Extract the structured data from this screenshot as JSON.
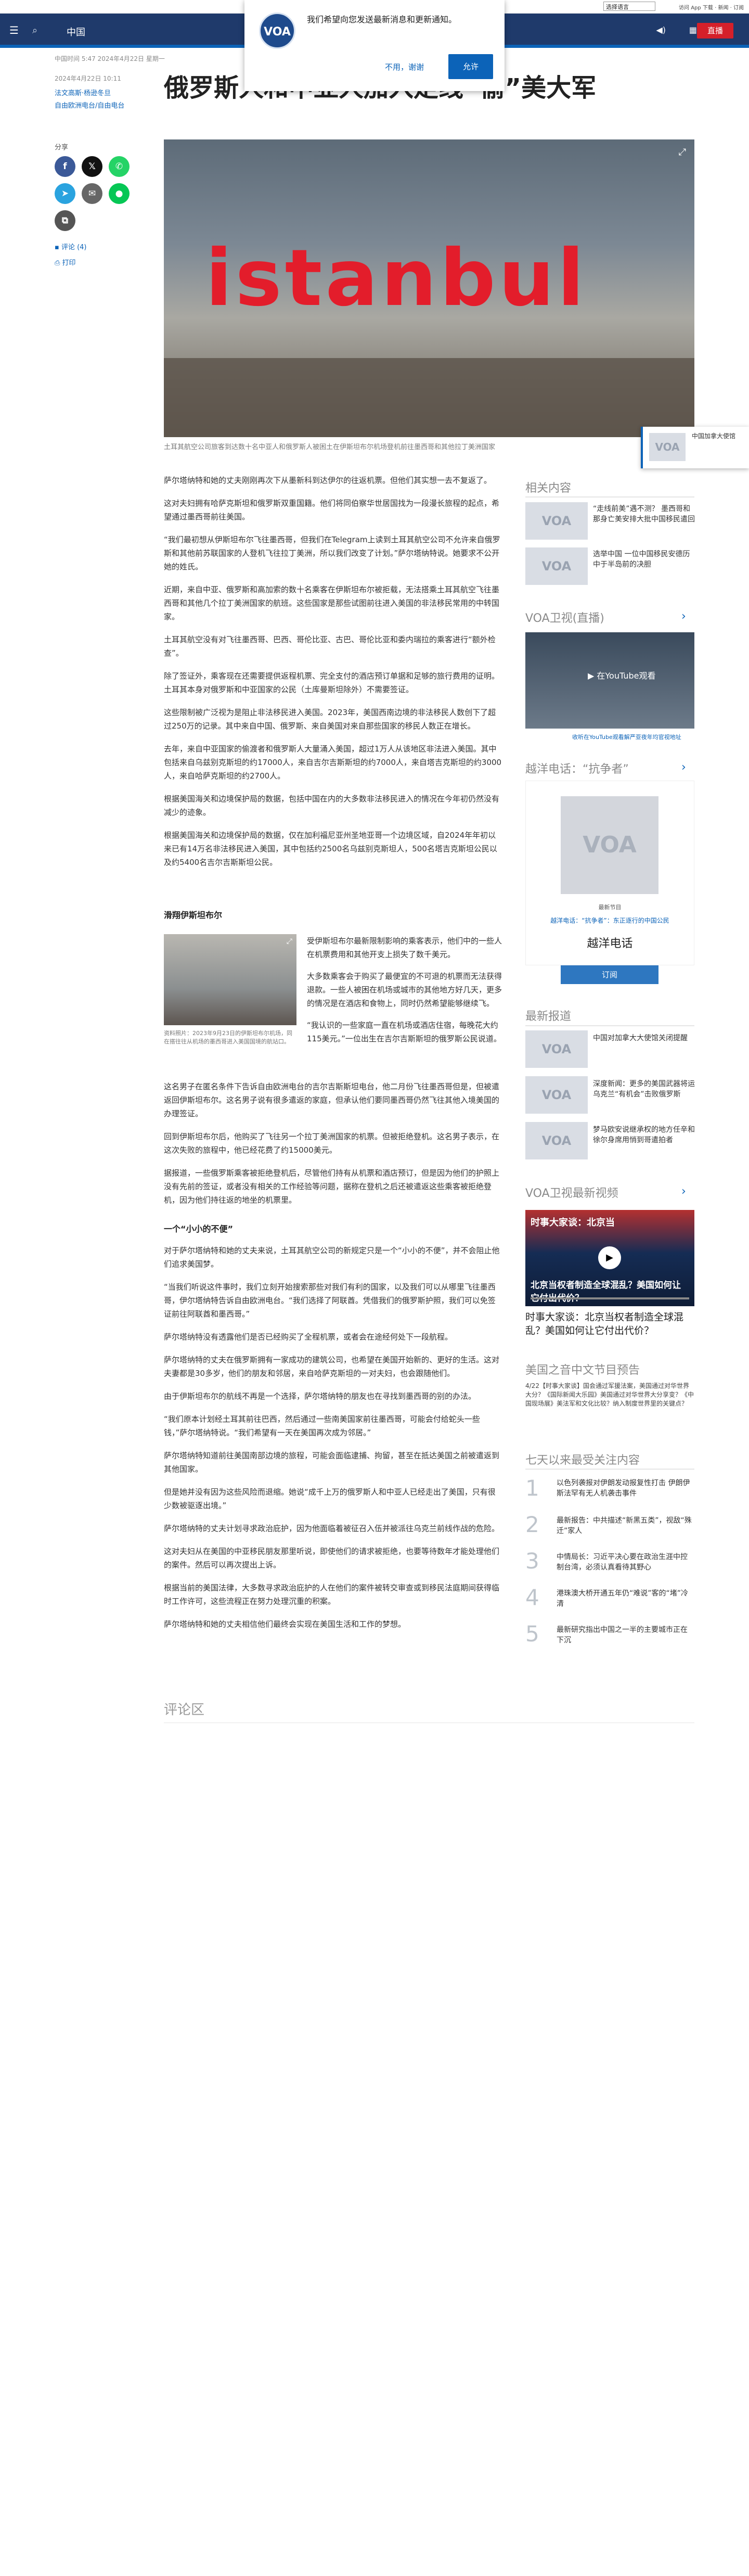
{
  "util": {
    "lang_selected": "选择语言",
    "links": "访问 App 下载 · 新闻 · 订阅"
  },
  "nav": {
    "menu_icon": "menu-icon",
    "search_icon": "search-icon",
    "section": "中国",
    "live_label": "直播"
  },
  "popup": {
    "logo": "VOA",
    "message": "我们希望向您发送最新消息和更新通知。",
    "decline": "不用，谢谢",
    "accept": "允许"
  },
  "meta": {
    "updated": "中国时间 5:47 2024年4月22日 星期一",
    "published": "2024年4月22日 10:11",
    "author_link": "法文高斯·杨逊冬旦",
    "outlet_link": "自由欧洲电台/自由电台"
  },
  "article": {
    "title": "俄罗斯人和中亚人加入走线“偷”美大军",
    "hero_sign": "istanbul",
    "hero_caption": "土耳其航空公司旅客到达数十名中亚人和俄罗斯人被困土在伊斯坦布尔机场登机前往墨西哥和其他拉丁美洲国家",
    "paragraphs_1": [
      "萨尔塔纳特和她的丈夫刚刚再次下从墨新科到达伊尔的往返机票。但他们其实想一去不复返了。",
      "这对夫妇拥有哈萨克斯坦和俄罗斯双重国籍。他们将同伯察华世居国找为一段漫长旅程的起点，希望通过墨西哥前往美国。",
      "“我们最初想从伊斯坦布尔飞往墨西哥，但我们在Telegram上读到土耳其航空公司不允许来自俄罗斯和其他前苏联国家的人登机飞往拉丁美洲，所以我们改变了计划。”萨尔塔纳特说。她要求不公开她的姓氏。",
      "近期，来自中亚、俄罗斯和高加索的数十名乘客在伊斯坦布尔被拒载，无法搭乘土耳其航空飞往墨西哥和其他几个拉丁美洲国家的航班。这些国家是那些试图前往进入美国的非法移民常用的中转国家。",
      "土耳其航空没有对飞往墨西哥、巴西、哥伦比亚、古巴、哥伦比亚和委内瑞拉的乘客进行“额外检查”。",
      "除了签证外，乘客现在还需要提供返程机票、完全支付的酒店预订单据和足够的旅行费用的证明。土耳其本身对俄罗斯和中亚国家的公民（土库曼斯坦除外）不需要签证。",
      "这些限制被广泛视为是阻止非法移民进入美国。2023年，美国西南边境的非法移民人数创下了超过250万的记录。其中来自中国、俄罗斯、来自美国对来自那些国家的移民人数正在增长。",
      "去年，来自中亚国家的偷渡者和俄罗斯人大量涌入美国，超过1万人从该地区非法进入美国。其中包括来自乌兹别克斯坦的约17000人，来自吉尔吉斯斯坦的约7000人，来自塔吉克斯坦的约3000人，来自哈萨克斯坦的约2700人。",
      "根据美国海关和边境保护局的数据，包括中国在内的大多数非法移民进入的情况在今年初仍然没有减少的迹象。",
      "根据美国海关和边境保护局的数据，仅在加利福尼亚州圣地亚哥一个边境区域，自2024年年初以来已有14万名非法移民进入美国，其中包括约2500名乌兹别克斯坦人，500名塔吉克斯坦公民以及约5400名吉尔吉斯斯坦公民。"
    ],
    "subhead_1": "滑翔伊斯坦布尔",
    "inline_caption": "资料照片：2023年9月23日的伊斯坦布尔机场，同在搭往往从机场的墨西哥进入美国国境的航站口。",
    "inline_paras": [
      "受伊斯坦布尔最新限制影响的乘客表示，他们中的一些人在机票费用和其他开支上损失了数千美元。",
      "大多数乘客会于购买了最便宜的不可退的机票而无法获得退款。一些人被困在机场或城市的其他地方好几天，更多的情况是在酒店和食物上，同时仍然希望能够继续飞。",
      "“我认识的一些家庭一直在机场或酒店住宿，每晚花大约115美元。”一位出生在吉尔吉斯斯坦的俄罗斯公民说道。"
    ],
    "paragraphs_2": [
      "这名男子在匿名条件下告诉自由欧洲电台的吉尔吉斯斯坦电台，他二月份飞往墨西哥但是，但被遣返回伊斯坦布尔。这名男子说有很多遣返的家庭，但承认他们要同墨西哥仍然飞往其他入境美国的办理签证。",
      "回到伊斯坦布尔后，他购买了飞往另一个拉丁美洲国家的机票。但被拒绝登机。这名男子表示，在这次失败的旅程中，他已经花费了约15000美元。",
      "据报道，一些俄罗斯乘客被拒绝登机后，尽管他们持有从机票和酒店预订，但是因为他们的护照上没有先前的签证，或者没有相关的工作经验等问题，据称在登机之后还被遣返这些乘客被拒绝登机，因为他们持往返的地坐的机票里。"
    ],
    "subhead_2": "一个“小小的不便”",
    "paragraphs_3": [
      "对于萨尔塔纳特和她的丈夫来说，土耳其航空公司的新规定只是一个“小小的不便”，并不会阻止他们追求美国梦。",
      "“当我们听说这件事时，我们立刻开始搜索那些对我们有利的国家，以及我们可以从哪里飞往墨西哥，伊尔塔纳特告诉自由欧洲电台。“我们选择了阿联酋。凭借我们的俄罗斯护照，我们可以免签证前往阿联酋和墨西哥。”",
      "萨尔塔纳特没有透露他们是否已经购买了全程机票，或者会在途经何处下一段航程。",
      "萨尔塔纳特的丈夫在俄罗斯拥有一家成功的建筑公司，也希望在美国开始新的、更好的生活。这对夫妻都是30多岁，他们的朋友和邻居，来自哈萨克斯坦的一对夫妇，也会跟随他们。",
      "由于伊斯坦布尔的航线不再是一个选择，萨尔塔纳特的朋友也在寻找到墨西哥的别的办法。",
      "“我们原本计划经土耳其前往巴西，然后通过一些南美国家前往墨西哥，可能会付给蛇头一些钱，”萨尔塔纳特说。“我们希望有一天在美国再次成为邻居。”",
      "萨尔塔纳特知道前往美国南部边境的旅程，可能会面临逮捕、拘留，甚至在抵达美国之前被遣返到其他国家。",
      "但是她并没有因为这些风险而退缩。她说“成千上万的俄罗斯人和中亚人已经走出了美国，只有很少数被驱逐出境。”",
      "萨尔塔纳特的丈夫计划寻求政治庇护，因为他面临着被征召入伍并被派往乌克兰前线作战的危险。",
      "这对夫妇从在美国的中亚移民朋友那里听说，即使他们的请求被拒绝，也要等待数年才能处理他们的案件。然后可以再次提出上诉。",
      "根据当前的美国法律，大多数寻求政治庇护的人在他们的案件被转交审查或到移民法庭期间获得临时工作许可，这些流程正在努力处理沉重的积案。",
      "萨尔塔纳特和她的丈夫相信他们最终会实现在美国生活和工作的梦想。"
    ],
    "comments_heading": "评论区"
  },
  "share": {
    "label": "分享",
    "comment_link": "评论 (4)",
    "print_link": "打印"
  },
  "sidebar": {
    "related_heading": "相关内容",
    "related": [
      {
        "thumb": "VOA",
        "text": "“走线前美”遇不测？ 墨西哥和那身亡美安排大批中国移民遣回"
      },
      {
        "thumb": "VOA",
        "text": "选举中国 一位中国移民安德历中于半岛前的决胆"
      }
    ],
    "live_heading": "VOA卫视(直播)",
    "live_video_label": "在YouTube观看",
    "live_caption": "收听在YouTube观看解严亚夜年均官视地址",
    "radio_heading": "越洋电话：“抗争者”",
    "radio_thumb": "VOA",
    "radio_small": "最新节目",
    "radio_link": "越洋电话：“抗争者”：东正逐行的中国公民",
    "radio_title": "越洋电话",
    "radio_subscribe": "订阅",
    "latest_heading": "最新报道",
    "latest": [
      {
        "thumb": "VOA",
        "text": "中国对加拿大大使馆关闭提醒"
      },
      {
        "thumb": "VOA",
        "text": "深度新闻：更多的美国武器将运乌克兰“有机会”击败俄罗斯"
      },
      {
        "thumb": "VOA",
        "text": "梦马欧安说继承权的地方任辛和徐尔身席用悄到哥遣拍者"
      }
    ],
    "video_heading": "VOA卫视最新视频",
    "video_overlay_top": "时事大家谈：北京当",
    "video_overlay_main": "北京当权者制造全球混乱？美国如何让它付出代价？",
    "video_title": "时事大家谈：北京当权者制造全球混乱？美国如何让它付出代价？",
    "program_heading": "美国之音中文节目预告",
    "program_text": "4/22【时事大家谈】国会通过军援法案，美国通过对华世界大分？《国际新闻大乐园》美国通过对华世界大分享变？《中国现场展》美法军和文化比较？纳入制度世界里的关键点？",
    "top_heading": "七天以来最受关注内容",
    "top": [
      {
        "n": "1",
        "text": "以色列袭报对伊朗发动报复性打击 伊朗伊斯法罕有无人机袭击事件"
      },
      {
        "n": "2",
        "text": "最新报告：中共描述“新黑五类”，视敌“殊迁”家人"
      },
      {
        "n": "3",
        "text": "中情局长：习近平决心要在政治生涯中控制台湾，必须认真看待其野心"
      },
      {
        "n": "4",
        "text": "港珠澳大桥开通五年仍“难说”客的“堵”冷清"
      },
      {
        "n": "5",
        "text": "最新研究指出中国之一半的主要城市正在下沉"
      }
    ]
  },
  "toast": {
    "logo": "VOA",
    "text": "中国加拿大使馆"
  }
}
